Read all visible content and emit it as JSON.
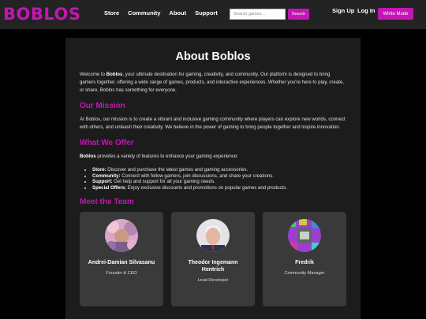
{
  "colors": {
    "accent": "#c416b3",
    "background": "#000000",
    "panel": "#1c1c1c",
    "card": "#3a3a3a",
    "header": "#232323"
  },
  "header": {
    "logo": "Boblos",
    "nav": [
      "Store",
      "Community",
      "About",
      "Support"
    ],
    "search_placeholder": "Search games...",
    "search_button": "Search",
    "signup": "Sign Up",
    "login": "Log In",
    "mode_button": "White Mode"
  },
  "about": {
    "title": "About Boblos",
    "intro_prefix": "Welcome to ",
    "intro_brand": "Boblos",
    "intro_rest": ", your ultimate destination for gaming, creativity, and community. Our platform is designed to bring gamers together, offering a wide range of games, products, and interactive experiences. Whether you're here to play, create, or share, Boblos has something for everyone."
  },
  "mission": {
    "heading": "Our Mission",
    "text": "At Boblos, our mission is to create a vibrant and inclusive gaming community where players can explore new worlds, connect with others, and unleash their creativity. We believe in the power of gaming to bring people together and inspire innovation."
  },
  "offer": {
    "heading": "What We Offer",
    "intro_brand": "Boblos",
    "intro_rest": " provides a variety of features to enhance your gaming experience:",
    "items": [
      {
        "label": "Store:",
        "text": " Discover and purchase the latest games and gaming accessories."
      },
      {
        "label": "Community:",
        "text": " Connect with fellow gamers, join discussions, and share your creations."
      },
      {
        "label": "Support:",
        "text": " Get help and support for all your gaming needs."
      },
      {
        "label": "Special Offers:",
        "text": " Enjoy exclusive discounts and promotions on popular games and products."
      }
    ]
  },
  "team": {
    "heading": "Meet the Team",
    "members": [
      {
        "name": "Andrei-Damian Silvasanu",
        "role": "Founder & CEO"
      },
      {
        "name": "Theodor Ingemann Hentrich",
        "role": "Lead Developer"
      },
      {
        "name": "Fredrik",
        "role": "Community Manager"
      }
    ]
  }
}
